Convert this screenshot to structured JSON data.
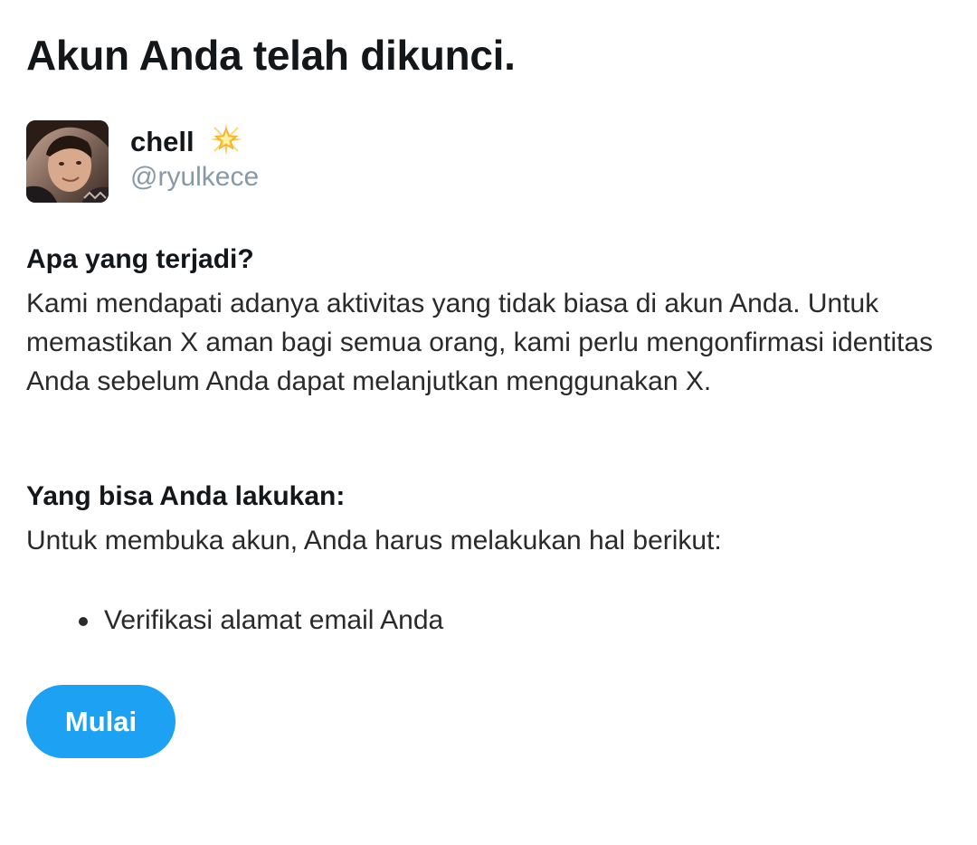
{
  "page": {
    "title": "Akun Anda telah dikunci."
  },
  "account": {
    "display_name": "chell",
    "name_emoji_icon": "glowing-star-icon",
    "handle": "@ryulkece"
  },
  "what_happened": {
    "heading": "Apa yang terjadi?",
    "body": "Kami mendapati adanya aktivitas yang tidak biasa di akun Anda. Untuk memastikan X aman bagi semua orang, kami perlu mengonfirmasi identitas Anda sebelum Anda dapat melanjutkan menggunakan X."
  },
  "what_you_can_do": {
    "heading": "Yang bisa Anda lakukan:",
    "body": "Untuk membuka akun, Anda harus melakukan hal berikut:",
    "steps": [
      "Verifikasi alamat email Anda"
    ]
  },
  "actions": {
    "start_label": "Mulai"
  },
  "colors": {
    "accent": "#1da1f2",
    "muted_text": "#8899a6",
    "text": "#14171a"
  }
}
